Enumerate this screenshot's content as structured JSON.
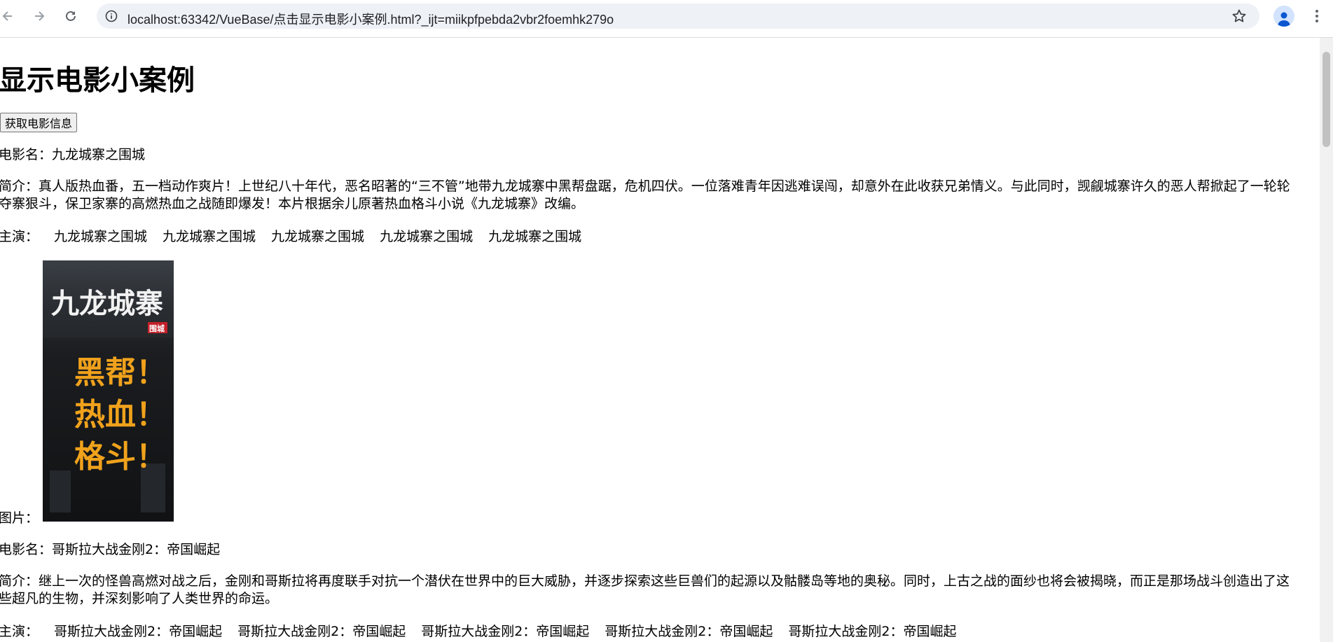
{
  "browser": {
    "url": "localhost:63342/VueBase/点击显示电影小案例.html?_ijt=miikpfpebda2vbr2foemhk279o"
  },
  "page": {
    "heading": "显示电影小案例",
    "fetch_button": "获取电影信息",
    "image_label": "图片：",
    "movies": [
      {
        "name_line": "电影名：九龙城寨之围城",
        "intro_line": "简介：真人版热血番，五一档动作爽片！上世纪八十年代，恶名昭著的“三不管”地带九龙城寨中黑帮盘踞，危机四伏。一位落难青年因逃难误闯，却意外在此收获兄弟情义。与此同时，觊觎城寨许久的恶人帮掀起了一轮轮夺寨狠斗，保卫家寨的高燃热血之战随即爆发！本片根据余儿原著热血格斗小说《九龙城寨》改编。",
        "cast_label": "主演：",
        "cast": [
          "九龙城寨之围城",
          "九龙城寨之围城",
          "九龙城寨之围城",
          "九龙城寨之围城",
          "九龙城寨之围城"
        ],
        "poster_text": [
          "九龙城寨",
          "围城",
          "黑帮！",
          "热血！",
          "格斗！"
        ]
      },
      {
        "name_line": "电影名：哥斯拉大战金刚2：帝国崛起",
        "intro_line": "简介：继上一次的怪兽高燃对战之后，金刚和哥斯拉将再度联手对抗一个潜伏在世界中的巨大威胁，并逐步探索这些巨兽们的起源以及骷髅岛等地的奥秘。同时，上古之战的面纱也将会被揭晓，而正是那场战斗创造出了这些超凡的生物，并深刻影响了人类世界的命运。",
        "cast_label": "主演：",
        "cast": [
          "哥斯拉大战金刚2：帝国崛起",
          "哥斯拉大战金刚2：帝国崛起",
          "哥斯拉大战金刚2：帝国崛起",
          "哥斯拉大战金刚2：帝国崛起",
          "哥斯拉大战金刚2：帝国崛起"
        ]
      }
    ]
  }
}
